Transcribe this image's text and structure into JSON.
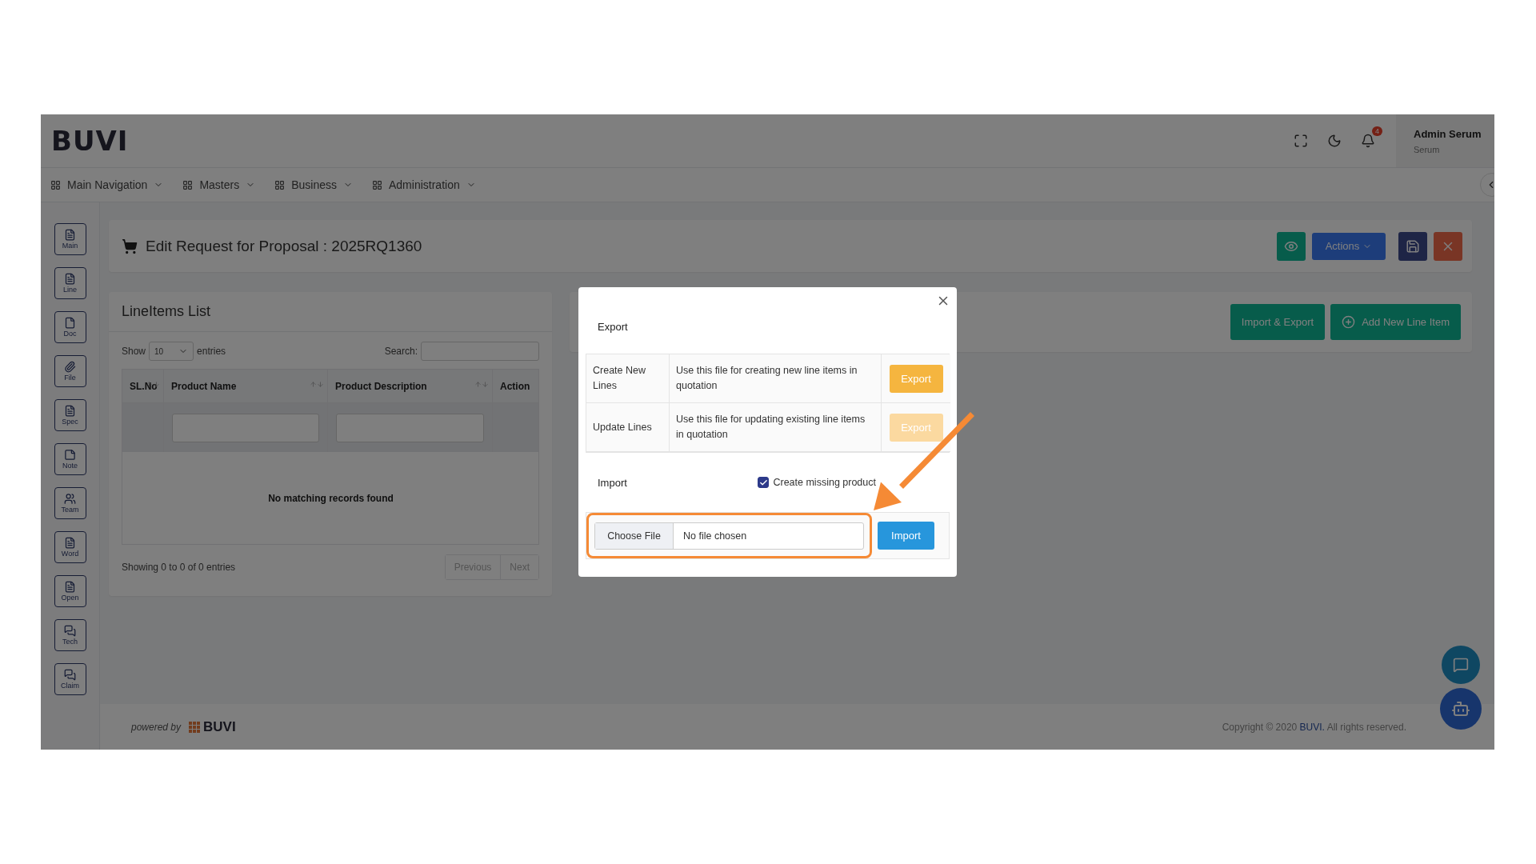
{
  "header": {
    "logo": "BUVI",
    "notification_count": "4",
    "user_name": "Admin Serum",
    "user_role": "Serum"
  },
  "nav": [
    {
      "label": "Main Navigation"
    },
    {
      "label": "Masters"
    },
    {
      "label": "Business"
    },
    {
      "label": "Administration"
    }
  ],
  "sidebar": [
    {
      "label": "Main",
      "kind": "list"
    },
    {
      "label": "Line",
      "kind": "list"
    },
    {
      "label": "Doc",
      "kind": "page"
    },
    {
      "label": "File",
      "kind": "clip"
    },
    {
      "label": "Spec",
      "kind": "list"
    },
    {
      "label": "Note",
      "kind": "note"
    },
    {
      "label": "Team",
      "kind": "team"
    },
    {
      "label": "Word",
      "kind": "list"
    },
    {
      "label": "Open",
      "kind": "list"
    },
    {
      "label": "Tech",
      "kind": "chat"
    },
    {
      "label": "Claim",
      "kind": "chat"
    }
  ],
  "page_title": "Edit Request for Proposal : 2025RQ1360",
  "toolbar": {
    "actions_label": "Actions"
  },
  "line_items": {
    "title": "LineItems List",
    "show": "Show",
    "page_size": "10",
    "entries": "entries",
    "search_label": "Search:",
    "columns": [
      {
        "label": "SL.No",
        "sortable": true,
        "filter": false
      },
      {
        "label": "Product Name",
        "sortable": true,
        "filter": true
      },
      {
        "label": "Product Description",
        "sortable": true,
        "filter": true
      },
      {
        "label": "Action",
        "sortable": false,
        "filter": false
      }
    ],
    "empty": "No matching records found",
    "info": "Showing 0 to 0 of 0 entries",
    "pager": [
      {
        "label": "Previous",
        "disabled": true
      },
      {
        "label": "Next",
        "disabled": true
      }
    ]
  },
  "right_buttons": [
    {
      "label": "Import & Export",
      "kind": "plain"
    },
    {
      "label": "Add New Line Item",
      "kind": "add"
    }
  ],
  "modal": {
    "export_title": "Export",
    "export_rows": [
      {
        "name": "Create New Lines",
        "description": "Use this file for creating new line items in quotation",
        "button": "Export",
        "disabled": false
      },
      {
        "name": "Update Lines",
        "description": "Use this file for updating existing line items in quotation",
        "button": "Export",
        "disabled": true
      }
    ],
    "import_title": "Import",
    "create_missing": {
      "label": "Create missing product",
      "checked": true
    },
    "choose_file": "Choose File",
    "file_status": "No file chosen",
    "import_button": "Import"
  },
  "footer": {
    "powered_by": "powered by",
    "brand": "BUVI",
    "copyright_prefix": "Copyright © 2020 ",
    "copyright_brand": "BUVI.",
    "copyright_suffix": " All rights reserved."
  }
}
